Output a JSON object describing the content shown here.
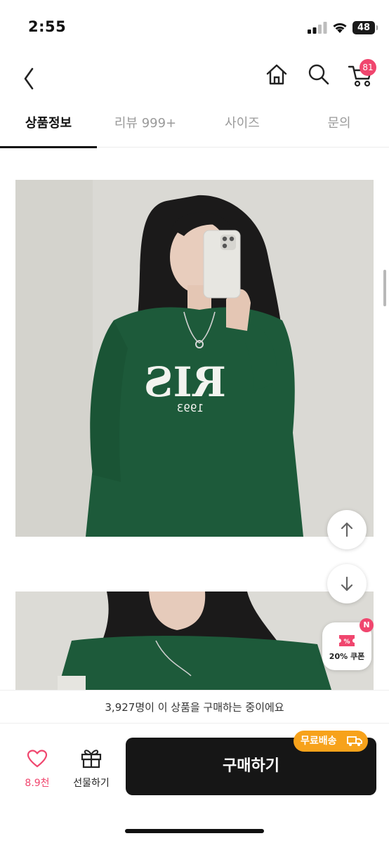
{
  "status_bar": {
    "time": "2:55",
    "battery": "48"
  },
  "header": {
    "cart_count": "81"
  },
  "tabs": [
    {
      "label": "상품정보",
      "active": true
    },
    {
      "label": "리뷰 999+",
      "active": false
    },
    {
      "label": "사이즈",
      "active": false
    },
    {
      "label": "문의",
      "active": false
    }
  ],
  "product_photo": {
    "print_text": "RIS",
    "print_year": "1993"
  },
  "coupon": {
    "label": "20% 쿠폰",
    "badge": "N"
  },
  "buyers_notice": "3,927명이 이 상품을 구매하는 중이에요",
  "bottom_bar": {
    "like_count": "8.9천",
    "gift_label": "선물하기",
    "buy_label": "구매하기",
    "free_shipping_label": "무료배송"
  },
  "colors": {
    "accent_pink": "#f0466e",
    "shipping_orange": "#f7a21b",
    "buy_button": "#161616",
    "sweatshirt_green": "#1d5a3a"
  }
}
